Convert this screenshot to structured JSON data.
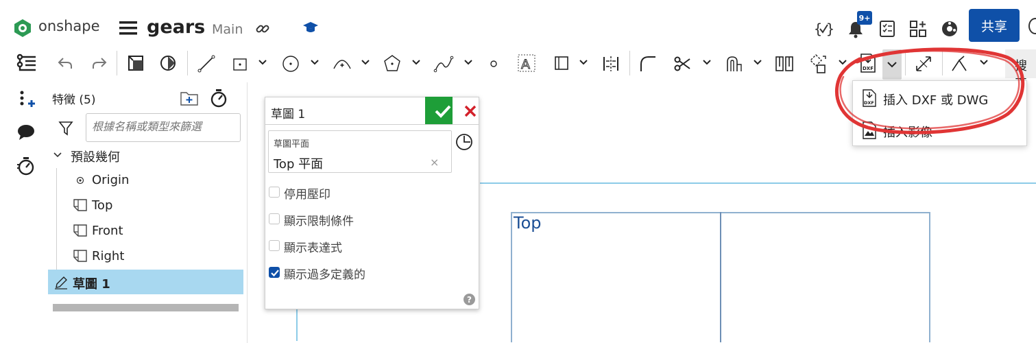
{
  "app": {
    "logo_text": "onshape",
    "document_name": "gears",
    "workspace": "Main",
    "notification_count": "9+",
    "share_label": "共享",
    "accent_color": "#0f50a8"
  },
  "toolbar": {
    "tools": [
      "undo-icon",
      "redo-icon",
      "model-icon",
      "gear-icon",
      "line-icon",
      "rectangle-icon",
      "circle-icon",
      "arc-icon",
      "polygon-icon",
      "spline-icon",
      "point-icon",
      "text-icon",
      "slot-icon",
      "mirror-icon",
      "fillet-icon",
      "trim-icon",
      "offset-icon",
      "pattern-icon",
      "transform-icon",
      "insert-dxf-icon",
      "dimension-icon",
      "construction-icon"
    ],
    "search_label": "搜索"
  },
  "features": {
    "title": "特徵 (5)",
    "filter_placeholder": "根據名稱或類型來篩選",
    "default_geometry": "預設幾何",
    "items": [
      {
        "label": "Origin",
        "icon": "origin-icon"
      },
      {
        "label": "Top",
        "icon": "plane-icon"
      },
      {
        "label": "Front",
        "icon": "plane-icon"
      },
      {
        "label": "Right",
        "icon": "plane-icon"
      }
    ],
    "sketch_label": "草圖 1"
  },
  "sketch_dialog": {
    "title": "草圖 1",
    "plane_label": "草圖平面",
    "plane_value": "Top 平面",
    "clear_symbol": "×",
    "options": [
      {
        "label": "停用壓印",
        "checked": false
      },
      {
        "label": "顯示限制條件",
        "checked": false
      },
      {
        "label": "顯示表達式",
        "checked": false
      },
      {
        "label": "顯示過多定義的",
        "checked": true
      }
    ],
    "help_symbol": "?"
  },
  "insert_menu": {
    "items": [
      {
        "label": "插入 DXF 或 DWG",
        "icon": "dxf-file-icon"
      },
      {
        "label": "插入影像",
        "icon": "image-file-icon"
      }
    ],
    "highlight_color": "#e03535"
  },
  "viewport": {
    "plane_label": "Top"
  }
}
